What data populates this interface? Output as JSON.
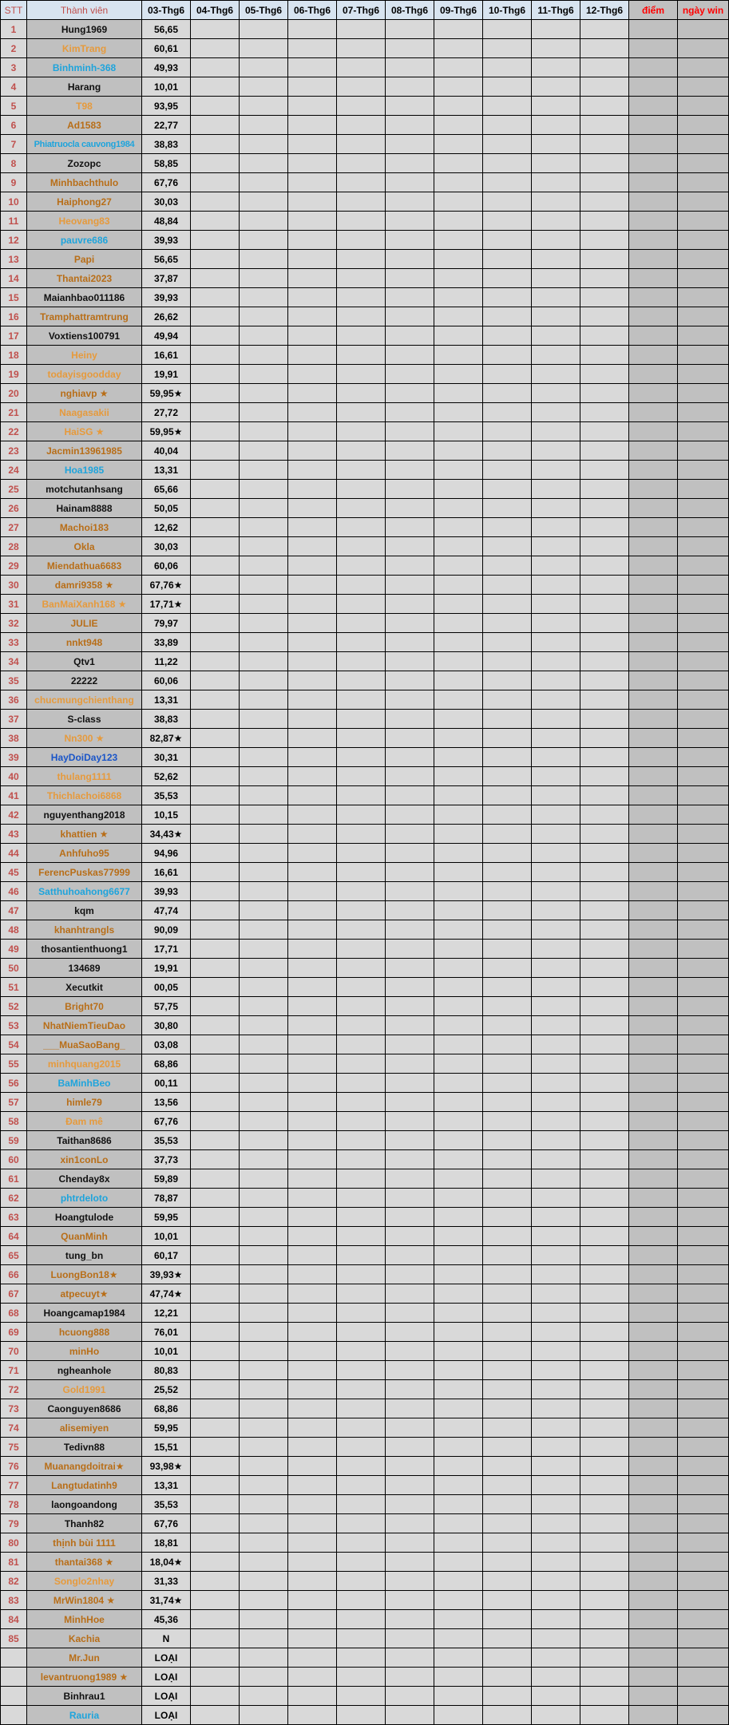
{
  "header": {
    "stt": "STT",
    "member": "Thành viên",
    "dates": [
      "03-Thg6",
      "04-Thg6",
      "05-Thg6",
      "06-Thg6",
      "07-Thg6",
      "08-Thg6",
      "09-Thg6",
      "10-Thg6",
      "11-Thg6",
      "12-Thg6"
    ],
    "points": "điểm",
    "win_days": "ngày win"
  },
  "colors": {
    "black": "#111111",
    "brown": "#b86e18",
    "orange": "#e69a3c",
    "cyan": "#1ea4dc",
    "blue": "#1a55c8",
    "stt_red": "#c0504d",
    "header_red": "#ff0000"
  },
  "rows": [
    {
      "stt": "1",
      "name": "Hung1969",
      "color": "black",
      "value": "56,65"
    },
    {
      "stt": "2",
      "name": "KimTrang",
      "color": "orange",
      "value": "60,61"
    },
    {
      "stt": "3",
      "name": "Binhminh-368",
      "color": "cyan",
      "value": "49,93"
    },
    {
      "stt": "4",
      "name": "Harang",
      "color": "black",
      "value": "10,01"
    },
    {
      "stt": "5",
      "name": "T98",
      "color": "orange",
      "value": "93,95"
    },
    {
      "stt": "6",
      "name": "Ad1583",
      "color": "brown",
      "value": "22,77"
    },
    {
      "stt": "7",
      "name": "Phiatruocla cauvong1984",
      "color": "cyan",
      "value": "38,83"
    },
    {
      "stt": "8",
      "name": "Zozopc",
      "color": "black",
      "value": "58,85"
    },
    {
      "stt": "9",
      "name": "Minhbachthulo",
      "color": "brown",
      "value": "67,76"
    },
    {
      "stt": "10",
      "name": "Haiphong27",
      "color": "brown",
      "value": "30,03"
    },
    {
      "stt": "11",
      "name": "Heovang83",
      "color": "orange",
      "value": "48,84"
    },
    {
      "stt": "12",
      "name": "pauvre686",
      "color": "cyan",
      "value": "39,93"
    },
    {
      "stt": "13",
      "name": "Papi",
      "color": "brown",
      "value": "56,65"
    },
    {
      "stt": "14",
      "name": "Thantai2023",
      "color": "brown",
      "value": "37,87"
    },
    {
      "stt": "15",
      "name": "Maianhbao011186",
      "color": "black",
      "value": "39,93"
    },
    {
      "stt": "16",
      "name": "Tramphattramtrung",
      "color": "brown",
      "value": "26,62"
    },
    {
      "stt": "17",
      "name": "Voxtiens100791",
      "color": "black",
      "value": "49,94"
    },
    {
      "stt": "18",
      "name": "Heiny",
      "color": "orange",
      "value": "16,61"
    },
    {
      "stt": "19",
      "name": "todayisgoodday",
      "color": "orange",
      "value": "19,91"
    },
    {
      "stt": "20",
      "name": "nghiavp ★",
      "color": "brown",
      "value": "59,95★"
    },
    {
      "stt": "21",
      "name": "Naagasakii",
      "color": "orange",
      "value": "27,72"
    },
    {
      "stt": "22",
      "name": "HaiSG ★",
      "color": "orange",
      "value": "59,95★"
    },
    {
      "stt": "23",
      "name": "Jacmin13961985",
      "color": "brown",
      "value": "40,04"
    },
    {
      "stt": "24",
      "name": "Hoa1985",
      "color": "cyan",
      "value": "13,31"
    },
    {
      "stt": "25",
      "name": "motchutanhsang",
      "color": "black",
      "value": "65,66"
    },
    {
      "stt": "26",
      "name": "Hainam8888",
      "color": "black",
      "value": "50,05"
    },
    {
      "stt": "27",
      "name": "Machoi183",
      "color": "brown",
      "value": "12,62"
    },
    {
      "stt": "28",
      "name": "Okla",
      "color": "brown",
      "value": "30,03"
    },
    {
      "stt": "29",
      "name": "Miendathua6683",
      "color": "brown",
      "value": "60,06"
    },
    {
      "stt": "30",
      "name": "damri9358 ★",
      "color": "brown",
      "value": "67,76★"
    },
    {
      "stt": "31",
      "name": "BanMaiXanh168 ★",
      "color": "orange",
      "value": "17,71★"
    },
    {
      "stt": "32",
      "name": "JULIE",
      "color": "brown",
      "value": "79,97"
    },
    {
      "stt": "33",
      "name": "nnkt948",
      "color": "brown",
      "value": "33,89"
    },
    {
      "stt": "34",
      "name": "Qtv1",
      "color": "black",
      "value": "11,22"
    },
    {
      "stt": "35",
      "name": "22222",
      "color": "black",
      "value": "60,06"
    },
    {
      "stt": "36",
      "name": "chucmungchienthang",
      "color": "orange",
      "value": "13,31"
    },
    {
      "stt": "37",
      "name": "S-class",
      "color": "black",
      "value": "38,83"
    },
    {
      "stt": "38",
      "name": "Nn300 ★",
      "color": "orange",
      "value": "82,87★"
    },
    {
      "stt": "39",
      "name": "HayDoiDay123",
      "color": "blue",
      "value": "30,31"
    },
    {
      "stt": "40",
      "name": "thulang1111",
      "color": "orange",
      "value": "52,62"
    },
    {
      "stt": "41",
      "name": "Thichlachoi6868",
      "color": "orange",
      "value": "35,53"
    },
    {
      "stt": "42",
      "name": "nguyenthang2018",
      "color": "black",
      "value": "10,15"
    },
    {
      "stt": "43",
      "name": "khattien ★",
      "color": "brown",
      "value": "34,43★"
    },
    {
      "stt": "44",
      "name": "Anhfuho95",
      "color": "brown",
      "value": "94,96"
    },
    {
      "stt": "45",
      "name": "FerencPuskas77999",
      "color": "brown",
      "value": "16,61"
    },
    {
      "stt": "46",
      "name": "Satthuhoahong6677",
      "color": "cyan",
      "value": "39,93"
    },
    {
      "stt": "47",
      "name": "kqm",
      "color": "black",
      "value": "47,74"
    },
    {
      "stt": "48",
      "name": "khanhtrangls",
      "color": "brown",
      "value": "90,09"
    },
    {
      "stt": "49",
      "name": "thosantienthuong1",
      "color": "black",
      "value": "17,71"
    },
    {
      "stt": "50",
      "name": "134689",
      "color": "black",
      "value": "19,91"
    },
    {
      "stt": "51",
      "name": "Xecutkit",
      "color": "black",
      "value": "00,05"
    },
    {
      "stt": "52",
      "name": "Bright70",
      "color": "brown",
      "value": "57,75"
    },
    {
      "stt": "53",
      "name": "NhatNiemTieuDao",
      "color": "brown",
      "value": "30,80"
    },
    {
      "stt": "54",
      "name": "___MuaSaoBang_",
      "color": "brown",
      "value": "03,08"
    },
    {
      "stt": "55",
      "name": "minhquang2015",
      "color": "orange",
      "value": "68,86"
    },
    {
      "stt": "56",
      "name": "BaMinhBeo",
      "color": "cyan",
      "value": "00,11"
    },
    {
      "stt": "57",
      "name": "himle79",
      "color": "brown",
      "value": "13,56"
    },
    {
      "stt": "58",
      "name": "Đam mê",
      "color": "orange",
      "value": "67,76"
    },
    {
      "stt": "59",
      "name": "Taithan8686",
      "color": "black",
      "value": "35,53"
    },
    {
      "stt": "60",
      "name": "xin1conLo",
      "color": "brown",
      "value": "37,73"
    },
    {
      "stt": "61",
      "name": "Chenday8x",
      "color": "black",
      "value": "59,89"
    },
    {
      "stt": "62",
      "name": "phtrdeloto",
      "color": "cyan",
      "value": "78,87"
    },
    {
      "stt": "63",
      "name": "Hoangtulode",
      "color": "black",
      "value": "59,95"
    },
    {
      "stt": "64",
      "name": "QuanMinh",
      "color": "brown",
      "value": "10,01"
    },
    {
      "stt": "65",
      "name": "tung_bn",
      "color": "black",
      "value": "60,17"
    },
    {
      "stt": "66",
      "name": "LuongBon18★",
      "color": "brown",
      "value": "39,93★"
    },
    {
      "stt": "67",
      "name": "atpecuyt★",
      "color": "brown",
      "value": "47,74★"
    },
    {
      "stt": "68",
      "name": "Hoangcamap1984",
      "color": "black",
      "value": "12,21"
    },
    {
      "stt": "69",
      "name": "hcuong888",
      "color": "brown",
      "value": "76,01"
    },
    {
      "stt": "70",
      "name": "minHo",
      "color": "brown",
      "value": "10,01"
    },
    {
      "stt": "71",
      "name": "ngheanhole",
      "color": "black",
      "value": "80,83"
    },
    {
      "stt": "72",
      "name": "Gold1991",
      "color": "orange",
      "value": "25,52"
    },
    {
      "stt": "73",
      "name": "Caonguyen8686",
      "color": "black",
      "value": "68,86"
    },
    {
      "stt": "74",
      "name": "alisemiyen",
      "color": "brown",
      "value": "59,95"
    },
    {
      "stt": "75",
      "name": "Tedivn88",
      "color": "black",
      "value": "15,51"
    },
    {
      "stt": "76",
      "name": "Muanangdoitrai★",
      "color": "brown",
      "value": "93,98★"
    },
    {
      "stt": "77",
      "name": "Langtudatinh9",
      "color": "brown",
      "value": "13,31"
    },
    {
      "stt": "78",
      "name": "laongoandong",
      "color": "black",
      "value": "35,53"
    },
    {
      "stt": "79",
      "name": "Thanh82",
      "color": "black",
      "value": "67,76"
    },
    {
      "stt": "80",
      "name": "thịnh bùi 1111",
      "color": "brown",
      "value": "18,81"
    },
    {
      "stt": "81",
      "name": "thantai368 ★",
      "color": "brown",
      "value": "18,04★"
    },
    {
      "stt": "82",
      "name": "Songlo2nhay",
      "color": "orange",
      "value": "31,33"
    },
    {
      "stt": "83",
      "name": "MrWin1804 ★",
      "color": "brown",
      "value": "31,74★"
    },
    {
      "stt": "84",
      "name": "MinhHoe",
      "color": "brown",
      "value": "45,36"
    },
    {
      "stt": "85",
      "name": "Kachia",
      "color": "brown",
      "value": "N"
    },
    {
      "stt": "",
      "name": "Mr.Jun",
      "color": "brown",
      "value": "LOẠI"
    },
    {
      "stt": "",
      "name": "levantruong1989 ★",
      "color": "brown",
      "value": "LOẠI"
    },
    {
      "stt": "",
      "name": "Binhrau1",
      "color": "black",
      "value": "LOẠI"
    },
    {
      "stt": "",
      "name": "Rauria",
      "color": "cyan",
      "value": "LOẠI"
    }
  ]
}
